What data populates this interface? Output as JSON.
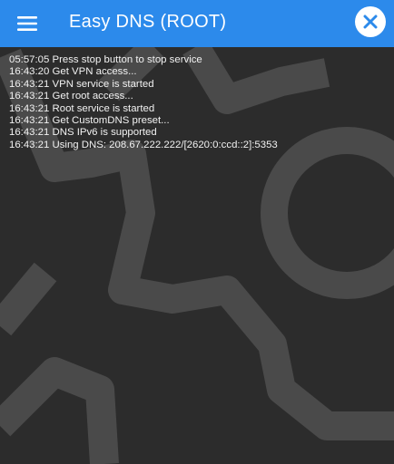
{
  "app": {
    "title": "Easy DNS (ROOT)"
  },
  "toolbar": {
    "menu_icon": "hamburger-menu-icon",
    "close_icon": "close-icon"
  },
  "colors": {
    "app_bar": "#2c8aeb",
    "background": "#2c2c2c",
    "gear": "#4a4a4a",
    "log_text": "#f2f2f2"
  },
  "log": {
    "lines": [
      "05:57:05 Press stop button to stop service",
      "16:43:20 Get VPN access...",
      "16:43:21 VPN service is started",
      "16:43:21 Get root access...",
      "16:43:21 Root service is started",
      "16:43:21 Get CustomDNS preset...",
      "16:43:21 DNS IPv6 is supported",
      "16:43:21 Using DNS: 208.67.222.222/[2620:0:ccd::2]:5353"
    ]
  }
}
